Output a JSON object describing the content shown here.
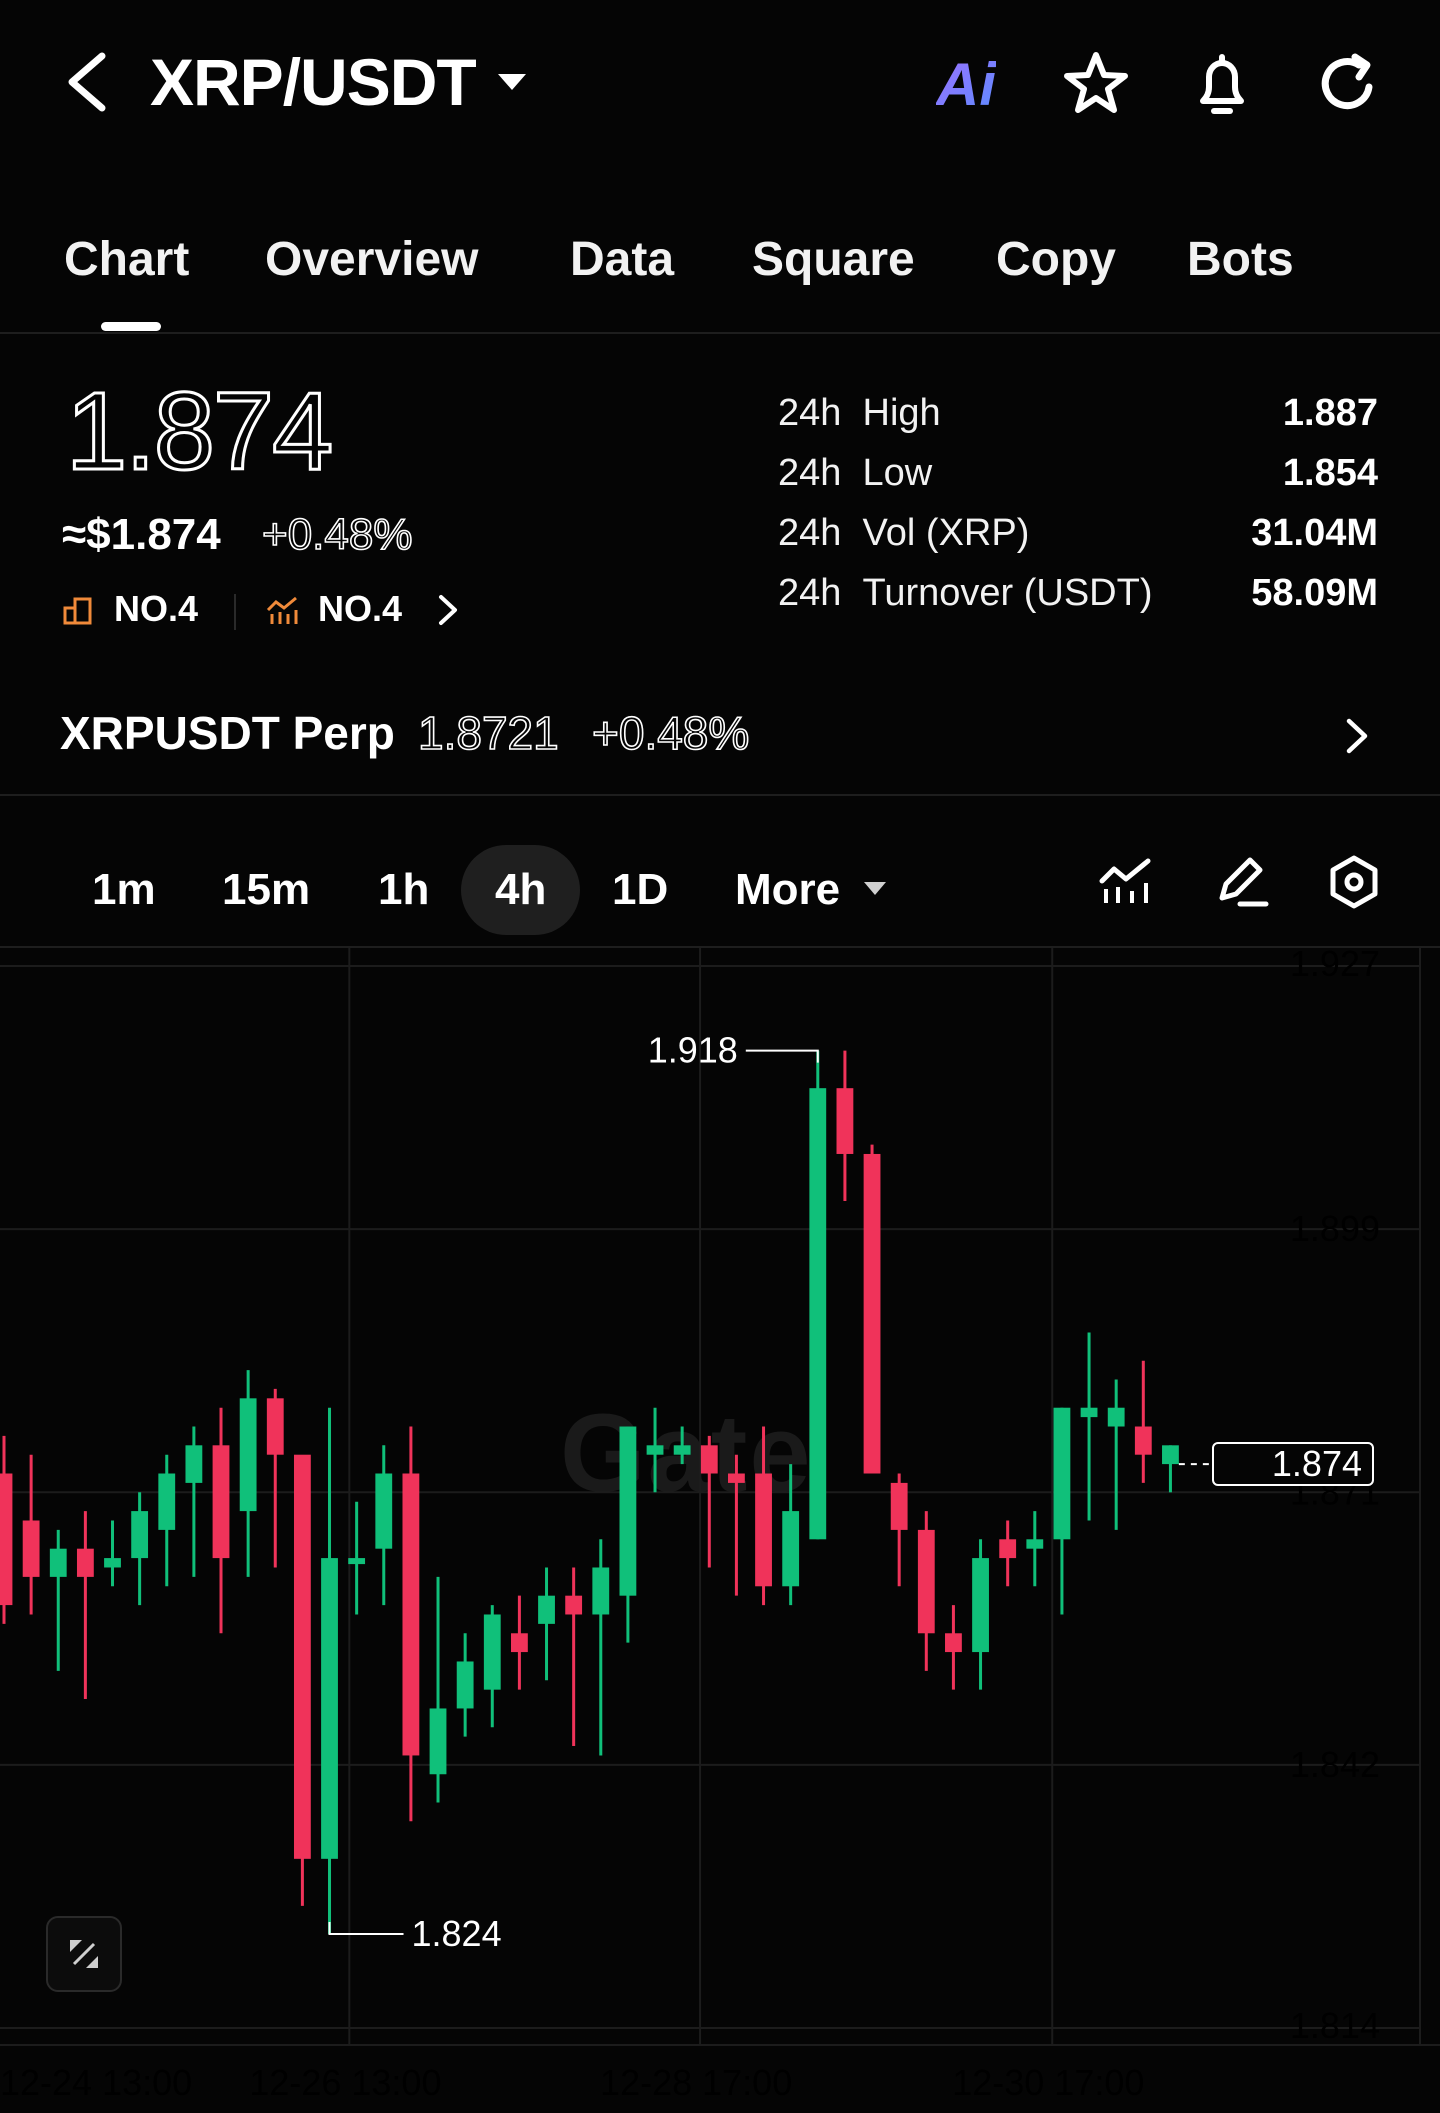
{
  "header": {
    "pair": "XRP/USDT",
    "ai_label": "Ai"
  },
  "tabs": [
    {
      "label": "Chart",
      "active": true
    },
    {
      "label": "Overview"
    },
    {
      "label": "Data"
    },
    {
      "label": "Square"
    },
    {
      "label": "Copy"
    },
    {
      "label": "Bots"
    }
  ],
  "price": {
    "last": "1.874",
    "usd": "≈$1.874",
    "change": "+0.48%",
    "rank_mcap": "NO.4",
    "rank_trend": "NO.4"
  },
  "stats": [
    {
      "period": "24h",
      "label": "High",
      "value": "1.887"
    },
    {
      "period": "24h",
      "label": "Low",
      "value": "1.854"
    },
    {
      "period": "24h",
      "label": "Vol (XRP)",
      "value": "31.04M"
    },
    {
      "period": "24h",
      "label": "Turnover (USDT)",
      "value": "58.09M"
    }
  ],
  "perp": {
    "name": "XRPUSDT Perp",
    "price": "1.8721",
    "change": "+0.48%"
  },
  "intervals": [
    {
      "label": "1m"
    },
    {
      "label": "15m"
    },
    {
      "label": "1h"
    },
    {
      "label": "4h",
      "active": true
    },
    {
      "label": "1D"
    },
    {
      "label": "More"
    }
  ],
  "colors": {
    "up": "#10c07a",
    "down": "#f0335a",
    "background": "#050505",
    "grid": "#1c1c1c"
  },
  "chart_data": {
    "type": "candlestick",
    "y_ticks": [
      "1.927",
      "1.899",
      "1.871",
      "1.842",
      "1.814"
    ],
    "x_ticks": [
      "12-24 13:00",
      "12-26 13:00",
      "12-28 17:00",
      "12-30 17:00"
    ],
    "ylim": [
      1.814,
      1.927
    ],
    "max_label": "1.918",
    "min_label": "1.824",
    "current_price": "1.874",
    "watermark": "Gate",
    "candles": [
      {
        "o": 1.873,
        "h": 1.877,
        "l": 1.857,
        "c": 1.859
      },
      {
        "o": 1.868,
        "h": 1.875,
        "l": 1.858,
        "c": 1.862
      },
      {
        "o": 1.862,
        "h": 1.867,
        "l": 1.852,
        "c": 1.865
      },
      {
        "o": 1.865,
        "h": 1.869,
        "l": 1.849,
        "c": 1.862
      },
      {
        "o": 1.863,
        "h": 1.868,
        "l": 1.861,
        "c": 1.864
      },
      {
        "o": 1.864,
        "h": 1.871,
        "l": 1.859,
        "c": 1.869
      },
      {
        "o": 1.867,
        "h": 1.875,
        "l": 1.861,
        "c": 1.873
      },
      {
        "o": 1.872,
        "h": 1.878,
        "l": 1.862,
        "c": 1.876
      },
      {
        "o": 1.876,
        "h": 1.88,
        "l": 1.856,
        "c": 1.864
      },
      {
        "o": 1.869,
        "h": 1.884,
        "l": 1.862,
        "c": 1.881
      },
      {
        "o": 1.881,
        "h": 1.882,
        "l": 1.863,
        "c": 1.875
      },
      {
        "o": 1.875,
        "h": 1.868,
        "l": 1.827,
        "c": 1.832
      },
      {
        "o": 1.832,
        "h": 1.88,
        "l": 1.824,
        "c": 1.864
      },
      {
        "o": 1.864,
        "h": 1.87,
        "l": 1.858,
        "c": 1.864
      },
      {
        "o": 1.865,
        "h": 1.876,
        "l": 1.859,
        "c": 1.873
      },
      {
        "o": 1.873,
        "h": 1.878,
        "l": 1.836,
        "c": 1.843
      },
      {
        "o": 1.841,
        "h": 1.862,
        "l": 1.838,
        "c": 1.848
      },
      {
        "o": 1.848,
        "h": 1.856,
        "l": 1.845,
        "c": 1.853
      },
      {
        "o": 1.85,
        "h": 1.859,
        "l": 1.846,
        "c": 1.858
      },
      {
        "o": 1.856,
        "h": 1.86,
        "l": 1.85,
        "c": 1.854
      },
      {
        "o": 1.857,
        "h": 1.863,
        "l": 1.851,
        "c": 1.86
      },
      {
        "o": 1.86,
        "h": 1.863,
        "l": 1.844,
        "c": 1.858
      },
      {
        "o": 1.858,
        "h": 1.866,
        "l": 1.843,
        "c": 1.863
      },
      {
        "o": 1.86,
        "h": 1.878,
        "l": 1.855,
        "c": 1.878
      },
      {
        "o": 1.875,
        "h": 1.88,
        "l": 1.871,
        "c": 1.876
      },
      {
        "o": 1.875,
        "h": 1.878,
        "l": 1.874,
        "c": 1.876
      },
      {
        "o": 1.876,
        "h": 1.877,
        "l": 1.863,
        "c": 1.873
      },
      {
        "o": 1.873,
        "h": 1.875,
        "l": 1.86,
        "c": 1.872
      },
      {
        "o": 1.873,
        "h": 1.878,
        "l": 1.859,
        "c": 1.861
      },
      {
        "o": 1.861,
        "h": 1.874,
        "l": 1.859,
        "c": 1.869
      },
      {
        "o": 1.866,
        "h": 1.918,
        "l": 1.866,
        "c": 1.914
      },
      {
        "o": 1.914,
        "h": 1.918,
        "l": 1.902,
        "c": 1.907
      },
      {
        "o": 1.907,
        "h": 1.908,
        "l": 1.875,
        "c": 1.873
      },
      {
        "o": 1.872,
        "h": 1.873,
        "l": 1.861,
        "c": 1.867
      },
      {
        "o": 1.867,
        "h": 1.869,
        "l": 1.852,
        "c": 1.856
      },
      {
        "o": 1.856,
        "h": 1.859,
        "l": 1.85,
        "c": 1.854
      },
      {
        "o": 1.854,
        "h": 1.866,
        "l": 1.85,
        "c": 1.864
      },
      {
        "o": 1.866,
        "h": 1.868,
        "l": 1.861,
        "c": 1.864
      },
      {
        "o": 1.865,
        "h": 1.869,
        "l": 1.861,
        "c": 1.866
      },
      {
        "o": 1.866,
        "h": 1.88,
        "l": 1.858,
        "c": 1.88
      },
      {
        "o": 1.879,
        "h": 1.888,
        "l": 1.868,
        "c": 1.88
      },
      {
        "o": 1.878,
        "h": 1.883,
        "l": 1.867,
        "c": 1.88
      },
      {
        "o": 1.878,
        "h": 1.885,
        "l": 1.872,
        "c": 1.875
      },
      {
        "o": 1.874,
        "h": 1.876,
        "l": 1.871,
        "c": 1.876
      }
    ]
  }
}
